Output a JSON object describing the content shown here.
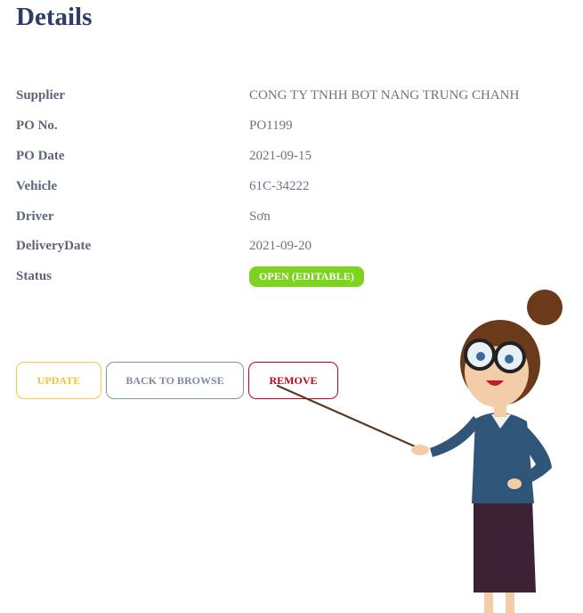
{
  "page": {
    "title": "Details"
  },
  "details": {
    "rows": [
      {
        "label": "Supplier",
        "value": "CONG TY TNHH BOT NANG TRUNG CHANH"
      },
      {
        "label": "PO No.",
        "value": "PO1199"
      },
      {
        "label": "PO Date",
        "value": "2021-09-15"
      },
      {
        "label": "Vehicle",
        "value": "61C-34222"
      },
      {
        "label": "Driver",
        "value": "Sơn"
      },
      {
        "label": "DeliveryDate",
        "value": "2021-09-20"
      }
    ],
    "status": {
      "label": "Status",
      "value": "OPEN (EDITABLE)",
      "color": "#7ed321"
    }
  },
  "actions": {
    "update_label": "UPDATE",
    "back_label": "BACK TO BROWSE",
    "remove_label": "REMOVE"
  },
  "colors": {
    "heading": "#2e3d63",
    "update": "#f2c230",
    "back": "#7d8aa0",
    "remove": "#c4001a"
  }
}
